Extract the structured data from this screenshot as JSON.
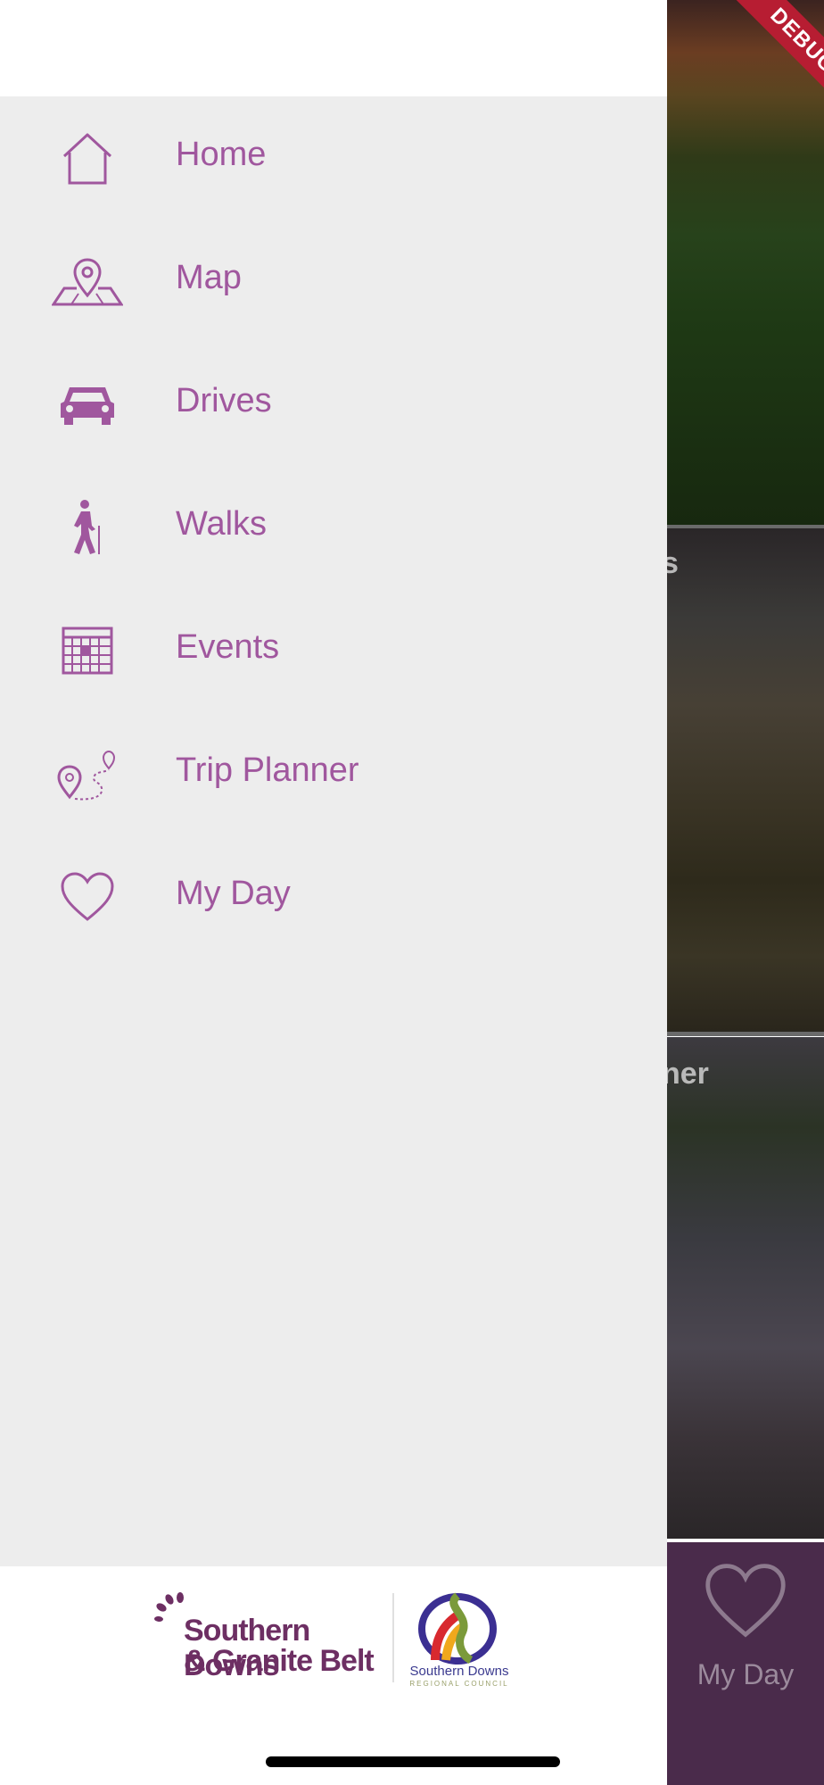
{
  "debug_banner": "DEBUG",
  "menu": {
    "items": [
      {
        "label": "Home",
        "icon": "home-icon"
      },
      {
        "label": "Map",
        "icon": "map-pin-icon"
      },
      {
        "label": "Drives",
        "icon": "car-icon"
      },
      {
        "label": "Walks",
        "icon": "hiker-icon"
      },
      {
        "label": "Events",
        "icon": "calendar-icon"
      },
      {
        "label": "Trip Planner",
        "icon": "route-pins-icon"
      },
      {
        "label": "My Day",
        "icon": "heart-icon"
      }
    ]
  },
  "footer": {
    "logo1_line1": "Southern Downs",
    "logo1_line2": "& Granite Belt",
    "logo2_line1": "Southern Downs",
    "logo2_line2": "REGIONAL COUNCIL"
  },
  "background": {
    "card1_title": "",
    "card2_title": "s",
    "card3_title": "ner",
    "tab_label": "My Day"
  },
  "colors": {
    "accent": "#a0579e",
    "drawer_bg": "#ededed",
    "brand_dark": "#6d2f63",
    "tab_bg": "#4a2b4b"
  }
}
